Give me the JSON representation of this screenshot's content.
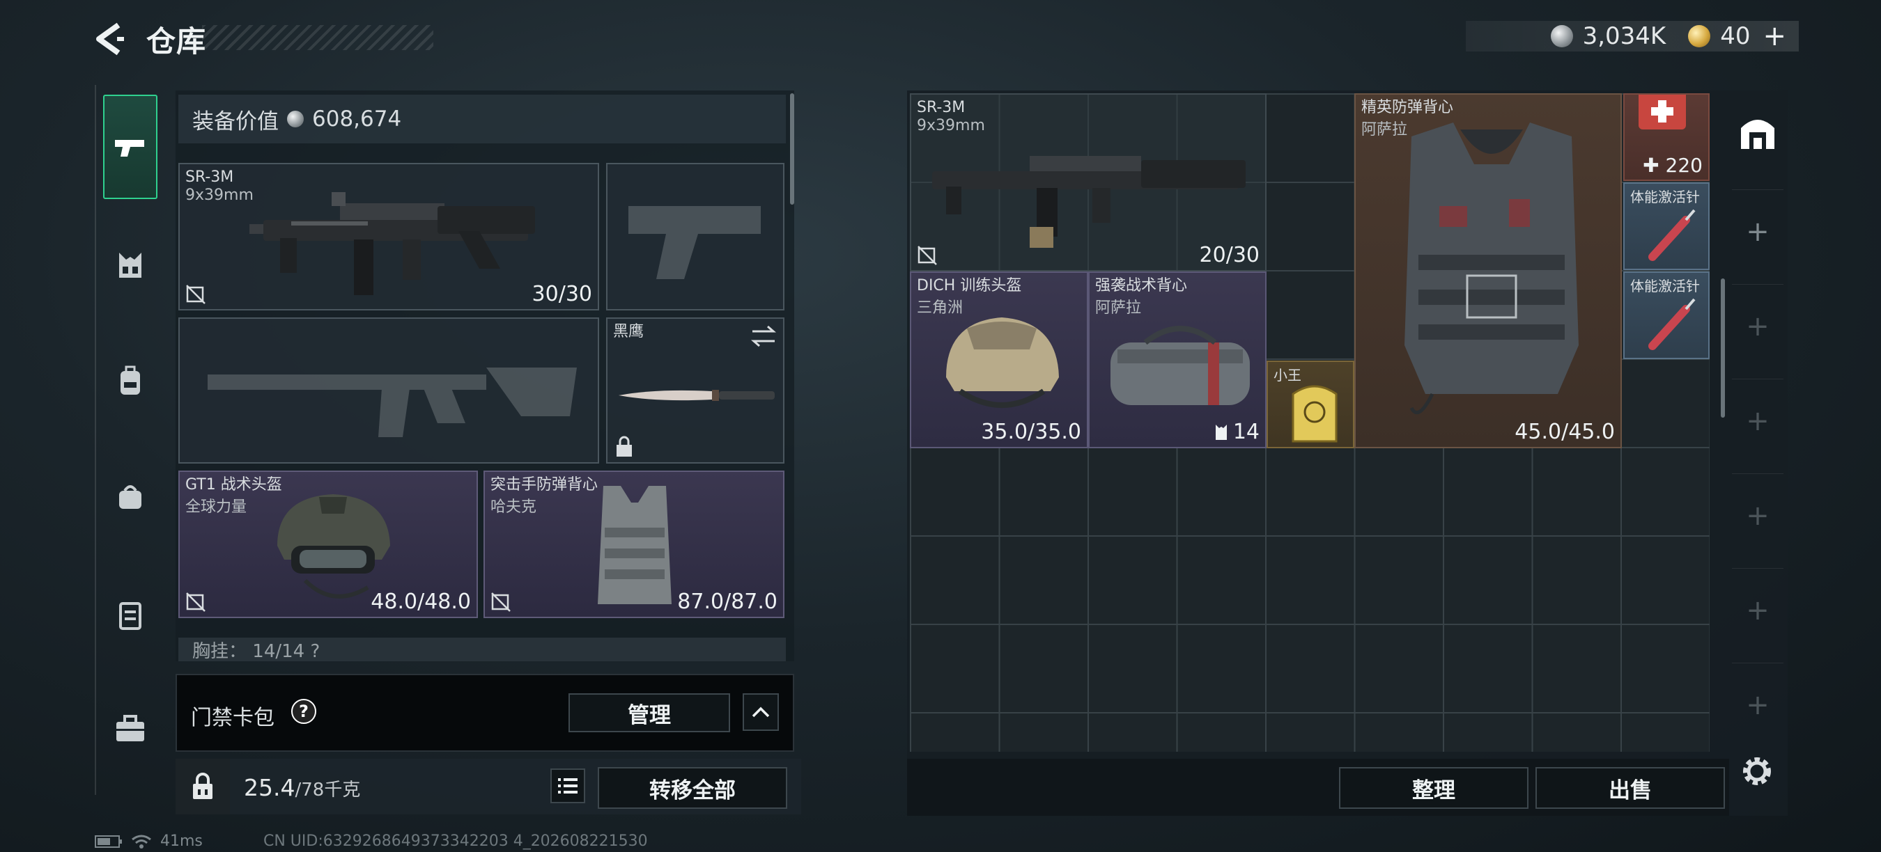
{
  "header": {
    "title": "仓库"
  },
  "currency": {
    "silver": "3,034K",
    "gold": "40"
  },
  "loadout": {
    "value_label": "装备价值",
    "value": "608,674",
    "primary": {
      "name": "SR-3M",
      "caliber": "9x39mm",
      "ammo": "30/30"
    },
    "melee": {
      "name": "黑鹰"
    },
    "helmet": {
      "name": "GT1 战术头盔",
      "faction": "全球力量",
      "durability": "48.0/48.0"
    },
    "armor": {
      "name": "突击手防弹背心",
      "faction": "哈夫克",
      "durability": "87.0/87.0"
    },
    "chest_rig": {
      "label": "胸挂：",
      "value": "14/14",
      "extra": "?"
    }
  },
  "access_card": {
    "label": "门禁卡包",
    "help": "?",
    "manage_label": "管理"
  },
  "weight": {
    "current": "25.4",
    "max": "/78千克"
  },
  "transfer_all_label": "转移全部",
  "storage": {
    "items": [
      {
        "name": "SR-3M",
        "sub": "9x39mm",
        "value": "20/30"
      },
      {
        "name": "精英防弹背心",
        "sub": "阿萨拉",
        "value": "45.0/45.0"
      },
      {
        "name": "",
        "sub": "",
        "value": "220"
      },
      {
        "name": "体能激活针",
        "sub": "",
        "value": ""
      },
      {
        "name": "体能激活针",
        "sub": "",
        "value": ""
      },
      {
        "name": "DICH 训练头盔",
        "sub": "三角洲",
        "value": "35.0/35.0"
      },
      {
        "name": "强袭战术背心",
        "sub": "阿萨拉",
        "value": "14"
      },
      {
        "name": "小王",
        "sub": "",
        "value": ""
      }
    ],
    "sort_label": "整理",
    "sell_label": "出售"
  },
  "status": {
    "ping": "41ms",
    "uid": "CN UID:6329268649373342203 4_202608221530"
  },
  "colors": {
    "accent": "#2fd18f",
    "purple_rarity": "#3b3850",
    "brown_rarity": "#4b3a2f",
    "gold_rarity": "#4e4129"
  }
}
